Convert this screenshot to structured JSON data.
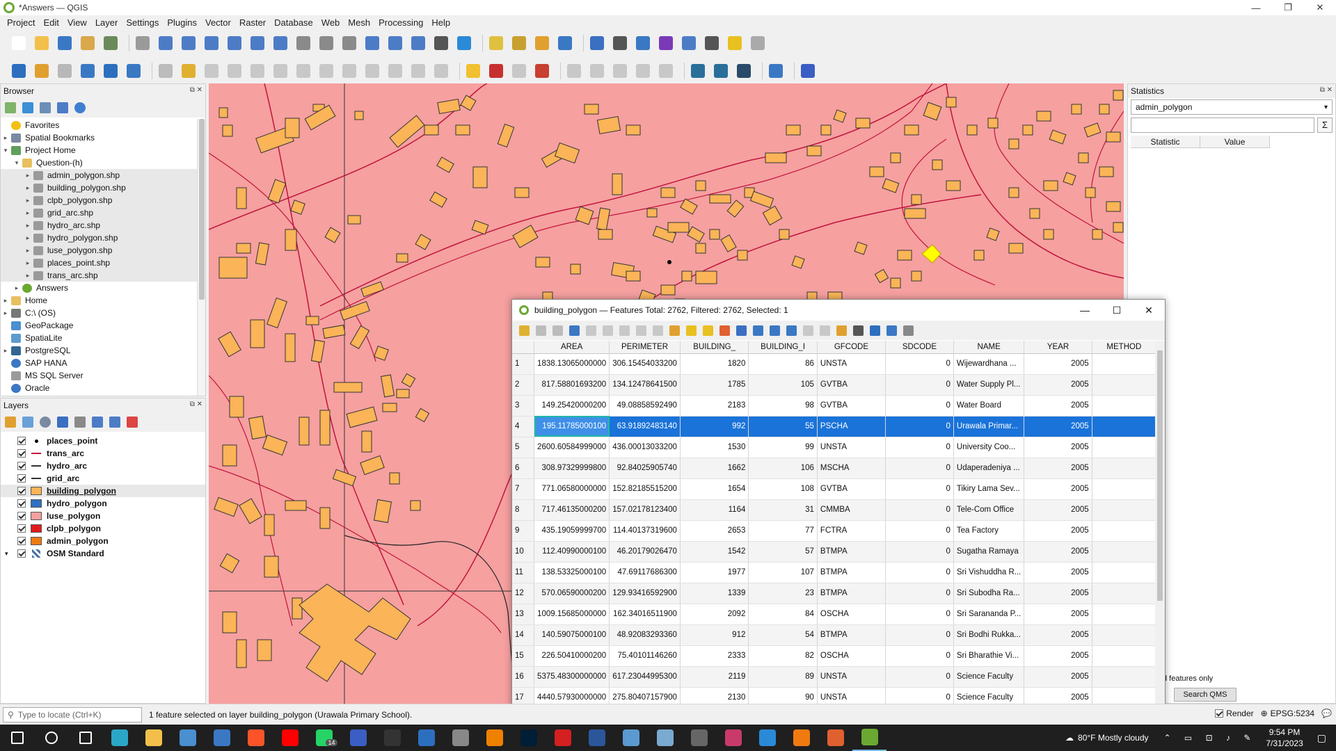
{
  "window": {
    "title": "*Answers — QGIS",
    "min": "—",
    "max": "❐",
    "close": "✕"
  },
  "menu": [
    "Project",
    "Edit",
    "View",
    "Layer",
    "Settings",
    "Plugins",
    "Vector",
    "Raster",
    "Database",
    "Web",
    "Mesh",
    "Processing",
    "Help"
  ],
  "browser": {
    "title": "Browser",
    "items": [
      {
        "label": "Favorites",
        "depth": 0,
        "arrow": "",
        "icon": "star"
      },
      {
        "label": "Spatial Bookmarks",
        "depth": 0,
        "arrow": "▸",
        "icon": "bookmark"
      },
      {
        "label": "Project Home",
        "depth": 0,
        "arrow": "▾",
        "icon": "folder-green"
      },
      {
        "label": "Question-(h)",
        "depth": 1,
        "arrow": "▾",
        "icon": "folder"
      },
      {
        "label": "admin_polygon.shp",
        "depth": 2,
        "arrow": "▸",
        "icon": "shp"
      },
      {
        "label": "building_polygon.shp",
        "depth": 2,
        "arrow": "▸",
        "icon": "shp"
      },
      {
        "label": "clpb_polygon.shp",
        "depth": 2,
        "arrow": "▸",
        "icon": "shp"
      },
      {
        "label": "grid_arc.shp",
        "depth": 2,
        "arrow": "▸",
        "icon": "shp"
      },
      {
        "label": "hydro_arc.shp",
        "depth": 2,
        "arrow": "▸",
        "icon": "shp"
      },
      {
        "label": "hydro_polygon.shp",
        "depth": 2,
        "arrow": "▸",
        "icon": "shp"
      },
      {
        "label": "luse_polygon.shp",
        "depth": 2,
        "arrow": "▸",
        "icon": "shp"
      },
      {
        "label": "places_point.shp",
        "depth": 2,
        "arrow": "▸",
        "icon": "shp"
      },
      {
        "label": "trans_arc.shp",
        "depth": 2,
        "arrow": "▸",
        "icon": "shp"
      },
      {
        "label": "Answers",
        "depth": 1,
        "arrow": "▸",
        "icon": "qgis"
      },
      {
        "label": "Home",
        "depth": 0,
        "arrow": "▸",
        "icon": "folder"
      },
      {
        "label": "C:\\ (OS)",
        "depth": 0,
        "arrow": "▸",
        "icon": "drive"
      },
      {
        "label": "GeoPackage",
        "depth": 0,
        "arrow": "",
        "icon": "gpkg"
      },
      {
        "label": "SpatiaLite",
        "depth": 0,
        "arrow": "",
        "icon": "spatialite"
      },
      {
        "label": "PostgreSQL",
        "depth": 0,
        "arrow": "▸",
        "icon": "postgres"
      },
      {
        "label": "SAP HANA",
        "depth": 0,
        "arrow": "",
        "icon": "hana"
      },
      {
        "label": "MS SQL Server",
        "depth": 0,
        "arrow": "",
        "icon": "mssql"
      },
      {
        "label": "Oracle",
        "depth": 0,
        "arrow": "",
        "icon": "oracle"
      }
    ]
  },
  "layers": {
    "title": "Layers",
    "items": [
      {
        "label": "places_point",
        "symbol": "point",
        "color": "#000000"
      },
      {
        "label": "trans_arc",
        "symbol": "line",
        "color": "#c0143c"
      },
      {
        "label": "hydro_arc",
        "symbol": "line",
        "color": "#333333"
      },
      {
        "label": "grid_arc",
        "symbol": "line",
        "color": "#333333"
      },
      {
        "label": "building_polygon",
        "symbol": "fill",
        "color": "#fbb457",
        "active": true
      },
      {
        "label": "hydro_polygon",
        "symbol": "fill",
        "color": "#2f6fbf"
      },
      {
        "label": "luse_polygon",
        "symbol": "fill",
        "color": "#f6a0a0"
      },
      {
        "label": "clpb_polygon",
        "symbol": "fill",
        "color": "#e31a1c"
      },
      {
        "label": "admin_polygon",
        "symbol": "fill",
        "color": "#f07a10"
      },
      {
        "label": "OSM Standard",
        "symbol": "raster",
        "color": "#4a6fa5",
        "group": true
      }
    ]
  },
  "map": {
    "background": "#f6a0a0",
    "building_color": "#fbb457",
    "road_color": "#c0143c",
    "selected_color": "#ffff00"
  },
  "stats": {
    "title": "Statistics",
    "layer": "admin_polygon",
    "col_statistic": "Statistic",
    "col_value": "Value",
    "sigma": "Σ",
    "selected_only": "d features only",
    "search_qms": "Search QMS"
  },
  "attribute_table": {
    "title": "building_polygon — Features Total: 2762, Filtered: 2762, Selected: 1",
    "columns": [
      "AREA",
      "PERIMETER",
      "BUILDING_",
      "BUILDING_I",
      "GFCODE",
      "SDCODE",
      "NAME",
      "YEAR",
      "METHOD"
    ],
    "selected_row": 4,
    "rows": [
      [
        "1",
        "1838.13065000000",
        "306.15454033200",
        "1820",
        "86",
        "UNSTA",
        "0",
        "Wijewardhana ...",
        "2005"
      ],
      [
        "2",
        "817.58801693200",
        "134.12478641500",
        "1785",
        "105",
        "GVTBA",
        "0",
        "Water Supply Pl...",
        "2005"
      ],
      [
        "3",
        "149.25420000200",
        "49.08858592490",
        "2183",
        "98",
        "GVTBA",
        "0",
        "Water Board",
        "2005"
      ],
      [
        "4",
        "195.11785000100",
        "63.91892483140",
        "992",
        "55",
        "PSCHA",
        "0",
        "Urawala Primar...",
        "2005"
      ],
      [
        "5",
        "2600.60584999000",
        "436.00013033200",
        "1530",
        "99",
        "UNSTA",
        "0",
        "University Coo...",
        "2005"
      ],
      [
        "6",
        "308.97329999800",
        "92.84025905740",
        "1662",
        "106",
        "MSCHA",
        "0",
        "Udaperadeniya ...",
        "2005"
      ],
      [
        "7",
        "771.06580000000",
        "152.82185515200",
        "1654",
        "108",
        "GVTBA",
        "0",
        "Tikiry Lama Sev...",
        "2005"
      ],
      [
        "8",
        "717.46135000200",
        "157.02178123400",
        "1164",
        "31",
        "CMMBA",
        "0",
        "Tele-Com Office",
        "2005"
      ],
      [
        "9",
        "435.19059999700",
        "114.40137319600",
        "2653",
        "77",
        "FCTRA",
        "0",
        "Tea Factory",
        "2005"
      ],
      [
        "10",
        "112.40990000100",
        "46.20179026470",
        "1542",
        "57",
        "BTMPA",
        "0",
        "Sugatha Ramaya",
        "2005"
      ],
      [
        "11",
        "138.53325000100",
        "47.69117686300",
        "1977",
        "107",
        "BTMPA",
        "0",
        "Sri Vishuddha R...",
        "2005"
      ],
      [
        "12",
        "570.06590000200",
        "129.93416592900",
        "1339",
        "23",
        "BTMPA",
        "0",
        "Sri Subodha Ra...",
        "2005"
      ],
      [
        "13",
        "1009.15685000000",
        "162.34016511900",
        "2092",
        "84",
        "OSCHA",
        "0",
        "Sri Sarananda P...",
        "2005"
      ],
      [
        "14",
        "140.59075000100",
        "48.92083293360",
        "912",
        "54",
        "BTMPA",
        "0",
        "Sri Bodhi Rukka...",
        "2005"
      ],
      [
        "15",
        "226.50410000200",
        "75.40101146260",
        "2333",
        "82",
        "OSCHA",
        "0",
        "Sri Bharathie Vi...",
        "2005"
      ],
      [
        "16",
        "5375.48300000000",
        "617.23044995300",
        "2119",
        "89",
        "UNSTA",
        "0",
        "Science Faculty",
        "2005"
      ],
      [
        "17",
        "4440.57930000000",
        "275.80407157900",
        "2130",
        "90",
        "UNSTA",
        "0",
        "Science Faculty",
        "2005"
      ]
    ]
  },
  "statusbar": {
    "locate_placeholder": "Type to locate (Ctrl+K)",
    "message": "1 feature selected on layer building_polygon (Urawala Primary School).",
    "render": "Render",
    "crs": "EPSG:5234"
  },
  "taskbar": {
    "weather": "80°F  Mostly cloudy",
    "time": "9:54 PM",
    "date": "7/31/2023",
    "whatsapp_badge": "14"
  }
}
